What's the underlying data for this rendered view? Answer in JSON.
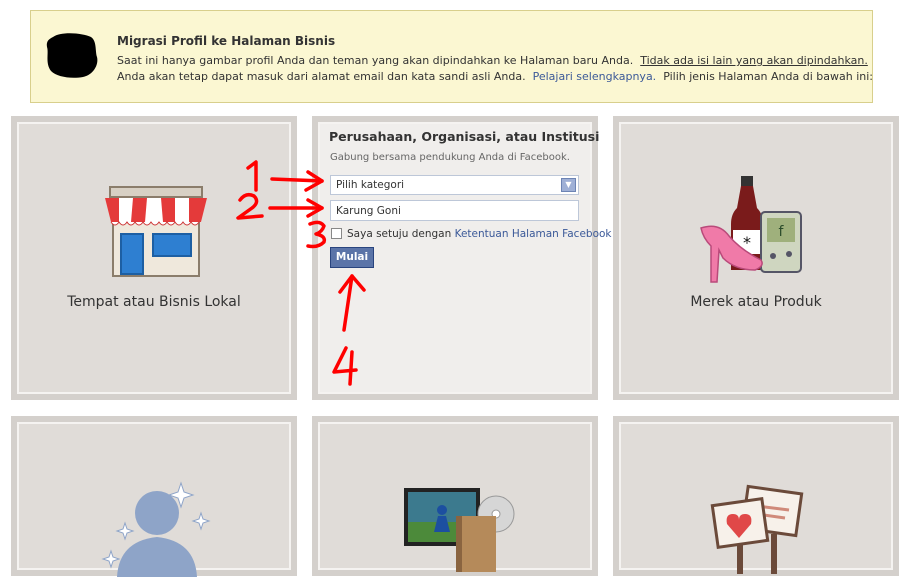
{
  "notice": {
    "title": "Migrasi Profil ke Halaman Bisnis",
    "line1_text": "Saat ini hanya gambar profil Anda dan teman yang akan dipindahkan ke Halaman baru Anda.",
    "line1_link": "Tidak ada isi lain yang akan dipindahkan.",
    "line2_text": "Anda akan tetap dapat masuk dari alamat email dan kata sandi asli Anda.",
    "line2_link": "Pelajari selengkapnya.",
    "line2_tail": "Pilih jenis Halaman Anda di bawah ini:"
  },
  "cards": {
    "local": {
      "label": "Tempat atau Bisnis Lokal",
      "icon": "storefront-icon"
    },
    "company": {
      "title": "Perusahaan, Organisasi, atau Institusi",
      "subtitle": "Gabung bersama pendukung Anda di Facebook.",
      "category_value": "Pilih kategori",
      "name_value": "Karung Goni",
      "agree_text": "Saya setuju dengan",
      "agree_link": "Ketentuan Halaman Facebook",
      "start_button": "Mulai"
    },
    "brand": {
      "label": "Merek atau Produk",
      "icon": "brand-products-icon"
    },
    "artist": {
      "icon": "public-figure-icon"
    },
    "entertainment": {
      "icon": "entertainment-icon"
    },
    "cause": {
      "icon": "cause-signs-icon"
    }
  },
  "annotations": {
    "step1": "1",
    "step2": "2",
    "step3": "3",
    "step4": "4",
    "color": "#ff0000"
  },
  "colors": {
    "notice_bg": "#fbf7d2",
    "card_bg": "#e0dcd8",
    "link": "#3b5998",
    "button": "#5b74a8"
  }
}
